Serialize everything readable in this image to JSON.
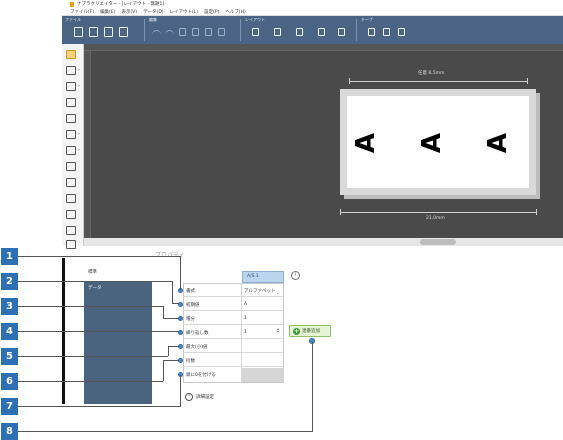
{
  "titlebar": {
    "title": "ナブラクリエイター - [レイアウト - 無題1]"
  },
  "menu": [
    "ファイル(F)",
    "編集(E)",
    "表示(V)",
    "データ(D)",
    "レイアウト(L)",
    "設定(P)",
    "ヘルプ(H)"
  ],
  "ribbon": {
    "groups": [
      {
        "label": "ファイル"
      },
      {
        "label": "編集"
      },
      {
        "label": "レイアウト"
      },
      {
        "label": "テープ"
      }
    ]
  },
  "canvas": {
    "top_dimension": "任意 8.5mm",
    "bottom_dimension": "21.0mm",
    "glyphs": [
      "A",
      "A",
      "A"
    ]
  },
  "panel": {
    "heading": "プロパティ",
    "nav": {
      "standard": "標準",
      "data": "データ"
    }
  },
  "grid": {
    "column_header": "A/S 1",
    "rows": [
      {
        "label": "書式",
        "value": "アルファベット"
      },
      {
        "label": "初期値",
        "value": "A"
      },
      {
        "label": "増分",
        "value": "1"
      },
      {
        "label": "繰り返し数",
        "value": "1"
      },
      {
        "label": "最大(小)値",
        "value": ""
      },
      {
        "label": "桁数",
        "value": ""
      },
      {
        "label": "頭に0を付ける",
        "value": ""
      }
    ],
    "add_button": "連番追加",
    "detail_toggle": "詳細設定"
  },
  "callouts": [
    "1",
    "2",
    "3",
    "4",
    "5",
    "6",
    "7",
    "8"
  ]
}
